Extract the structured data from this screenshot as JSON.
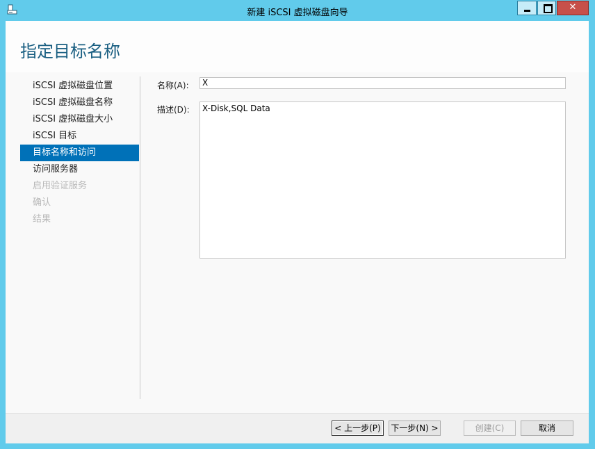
{
  "window": {
    "title": "新建 iSCSI 虚拟磁盘向导",
    "minimize_glyph": "",
    "close_glyph": "✕"
  },
  "page": {
    "title": "指定目标名称"
  },
  "nav": {
    "items": [
      {
        "label": "iSCSI 虚拟磁盘位置",
        "state": "normal"
      },
      {
        "label": "iSCSI 虚拟磁盘名称",
        "state": "normal"
      },
      {
        "label": "iSCSI 虚拟磁盘大小",
        "state": "normal"
      },
      {
        "label": "iSCSI 目标",
        "state": "normal"
      },
      {
        "label": "目标名称和访问",
        "state": "active"
      },
      {
        "label": "访问服务器",
        "state": "normal"
      },
      {
        "label": "启用验证服务",
        "state": "disabled"
      },
      {
        "label": "确认",
        "state": "disabled"
      },
      {
        "label": "结果",
        "state": "disabled"
      }
    ]
  },
  "form": {
    "name_label": "名称(A):",
    "name_value": "X",
    "description_label": "描述(D):",
    "description_value": "X-Disk,SQL Data"
  },
  "buttons": {
    "back": "< 上一步(P)",
    "next": "下一步(N) >",
    "create": "创建(C)",
    "cancel": "取消"
  },
  "colors": {
    "titlebar": "#61cbeb",
    "accent_selected": "#0071b8",
    "title_text": "#1a5f82",
    "close_button": "#c7504a"
  }
}
